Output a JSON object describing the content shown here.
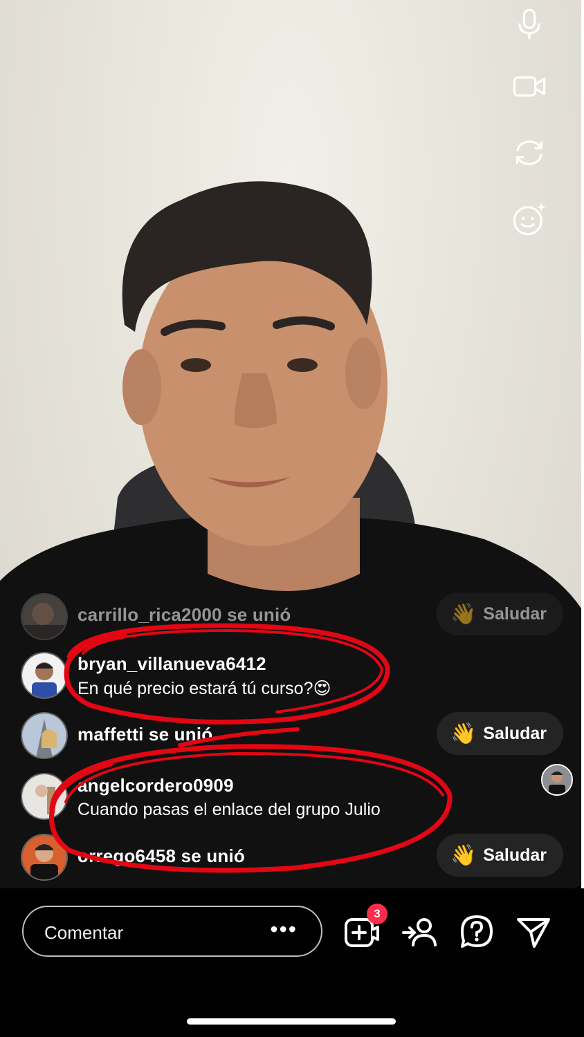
{
  "side_controls": {
    "mic": "microphone-icon",
    "camera": "video-camera-icon",
    "flip": "flip-camera-icon",
    "effects": "face-effects-icon"
  },
  "comments": [
    {
      "avatar": "avatar-1",
      "text": "carrillo_rica2000 se unió",
      "type": "join",
      "button": "Saludar",
      "dim": true
    },
    {
      "avatar": "avatar-2",
      "username": "bryan_villanueva6412",
      "text": "En qué precio estará tú curso?😍",
      "type": "comment"
    },
    {
      "avatar": "avatar-3",
      "text": "maffetti se unió",
      "type": "join",
      "button": "Saludar"
    },
    {
      "avatar": "avatar-4",
      "username": "angelcordero0909",
      "text": "Cuando pasas el enlace del grupo Julio",
      "type": "comment"
    },
    {
      "avatar": "avatar-5",
      "text": "orrego6458 se unió",
      "type": "join",
      "button": "Saludar"
    }
  ],
  "wave_emoji": "👋",
  "bottom_bar": {
    "comment_placeholder": "Comentar",
    "more": "•••",
    "requests_badge": "3"
  },
  "colors": {
    "annotation": "#e30613",
    "badge": "#ff2d4a"
  }
}
